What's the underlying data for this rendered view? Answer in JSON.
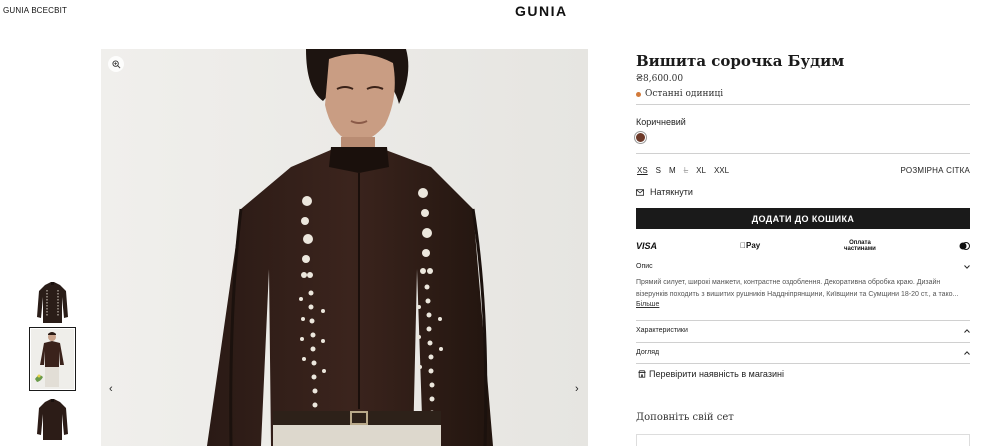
{
  "header": {
    "nav_link": "GUNIA ВСЕСВІТ",
    "logo": "GUNIA"
  },
  "gallery": {
    "thumbnails": [
      {
        "name": "front",
        "active": false
      },
      {
        "name": "model",
        "active": true
      },
      {
        "name": "back",
        "active": false
      }
    ],
    "prev_arrow": "‹",
    "next_arrow": "›"
  },
  "product": {
    "title": "Вишита сорочка Будим",
    "price": "₴8,600.00",
    "stock_status": "Останні одиниці",
    "stock_color": "#d27a3a",
    "color_name": "Коричневий",
    "swatch_color": "#6d3a2a",
    "sizes": [
      {
        "label": "XS",
        "state": "selected"
      },
      {
        "label": "S",
        "state": "available"
      },
      {
        "label": "M",
        "state": "available"
      },
      {
        "label": "L",
        "state": "disabled"
      },
      {
        "label": "XL",
        "state": "available"
      },
      {
        "label": "XXL",
        "state": "available"
      }
    ],
    "size_chart_label": "РОЗМІРНА СІТКА",
    "hint_label": "Натякнути",
    "add_to_cart_label": "ДОДАТИ ДО КОШИКА",
    "payment": {
      "visa": "VISA",
      "apple_pay": "Pay",
      "parts_line1": "Оплата",
      "parts_line2": "частинами"
    }
  },
  "accordion": {
    "description_header": "Опис",
    "description_text": "Прямий силует, широкі манжети, контрастне оздоблення. Декоративна обробка краю. Дизайн візерунків походить з вишитих рушників Наддніпрянщини, Київщини та Сумщини 18-20 ст., а тако...",
    "more_label": "Більше",
    "specs_header": "Характеристики",
    "care_header": "Догляд"
  },
  "store_check_label": "Перевірити наявність в магазині",
  "complete_set_title": "Доповніть свій сет"
}
